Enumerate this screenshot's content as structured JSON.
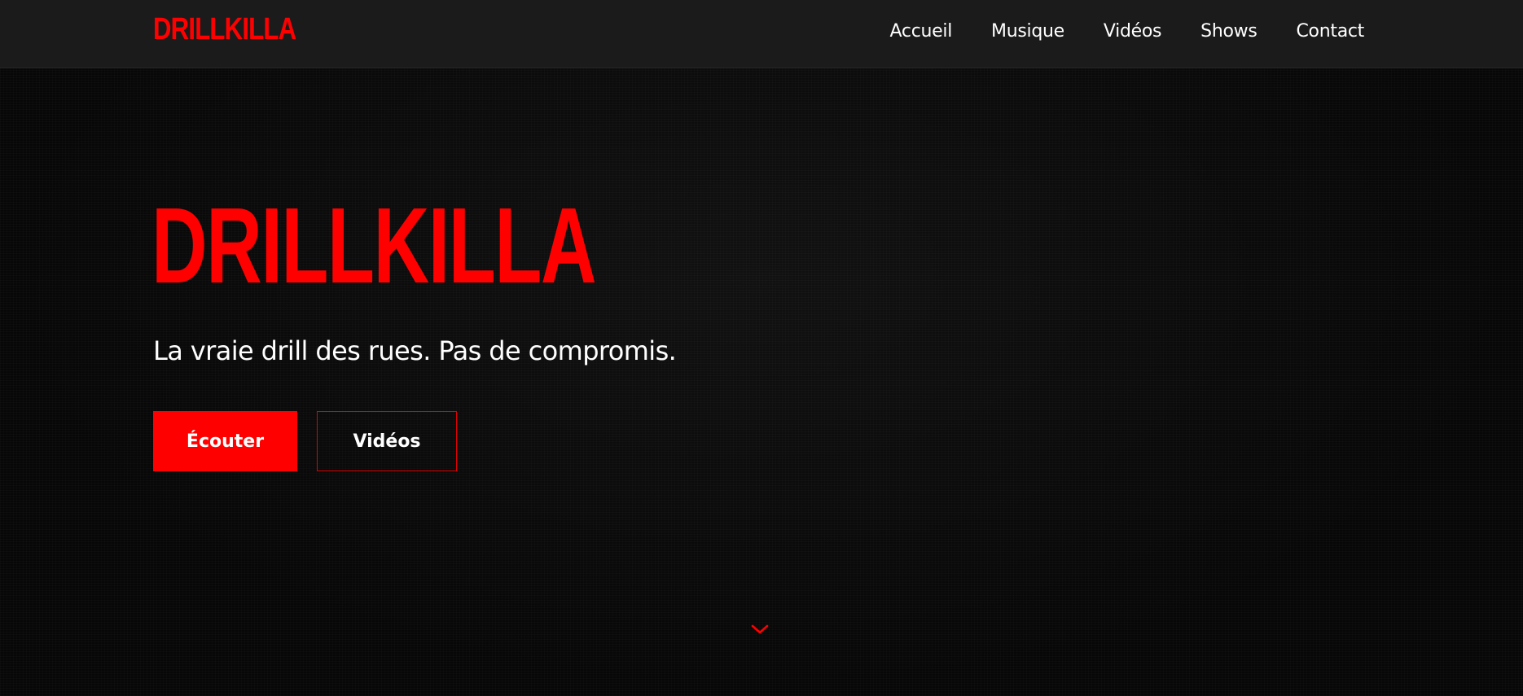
{
  "header": {
    "brand": "DRILLKILLA",
    "nav": [
      {
        "label": "Accueil"
      },
      {
        "label": "Musique"
      },
      {
        "label": "Vidéos"
      },
      {
        "label": "Shows"
      },
      {
        "label": "Contact"
      }
    ]
  },
  "hero": {
    "title": "DRILLKILLA",
    "subtitle": "La vraie drill des rues. Pas de compromis.",
    "primary_button": "Écouter",
    "secondary_button": "Vidéos",
    "scroll_icon": "chevron-down-icon"
  },
  "colors": {
    "accent": "#ff0000",
    "background": "#080808",
    "navbar": "#1b1b1b",
    "text": "#ffffff"
  }
}
